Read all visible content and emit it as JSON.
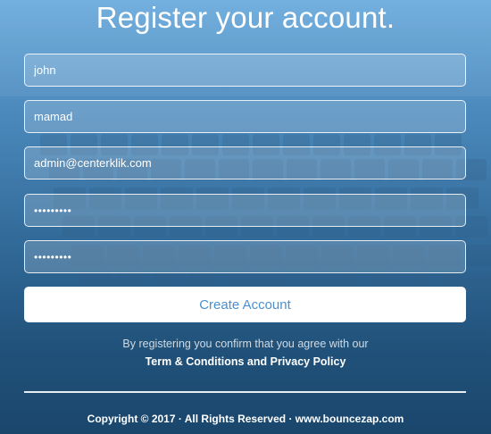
{
  "header": {
    "title": "Register your account."
  },
  "form": {
    "first_name_value": "john",
    "last_name_value": "mamad",
    "email_value": "admin@centerklik.com",
    "password_value": "•••••••••",
    "confirm_password_value": "•••••••••",
    "submit_label": "Create Account"
  },
  "agreement": {
    "notice": "By registering you confirm that you agree with our",
    "terms_link": "Term & Conditions and Privacy Policy"
  },
  "footer": {
    "copyright": "Copyright © 2017 · All Rights Reserved · www.bouncezap.com"
  },
  "colors": {
    "accent": "#4a90d0",
    "background_top": "#5aa2d9",
    "background_bottom": "#1d4e78"
  }
}
